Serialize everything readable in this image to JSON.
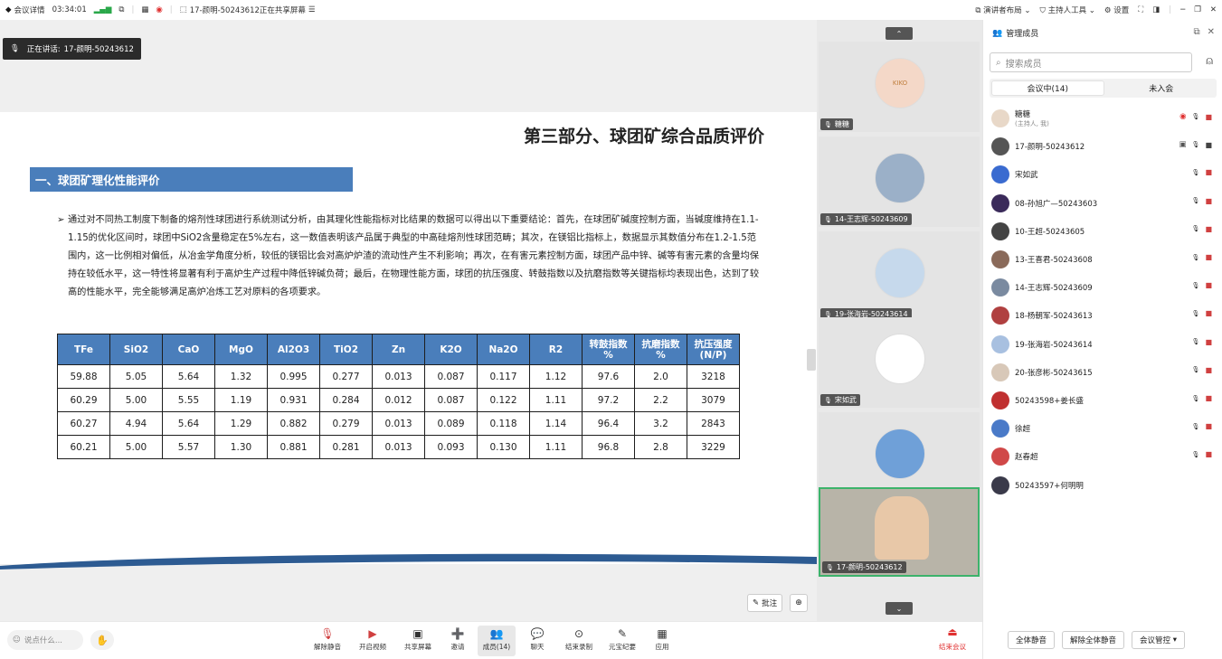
{
  "topbar": {
    "meeting_details": "会议详情",
    "duration": "03:34:01",
    "sharing": "17-颜明-50243612正在共享屏幕",
    "presenter_layout": "演讲者布局",
    "host_tools": "主持人工具",
    "settings": "设置"
  },
  "share": {
    "speaking_prefix": "正在讲话:",
    "speaking_name": "17-颜明-50243612"
  },
  "slide": {
    "title": "第三部分、球团矿综合品质评价",
    "section": "一、球团矿理化性能评价",
    "paragraph": "通过对不同热工制度下制备的熔剂性球团进行系统测试分析，由其理化性能指标对比结果的数据可以得出以下重要结论：首先，在球团矿碱度控制方面，当碱度维持在1.1-1.15的优化区间时，球团中SiO2含量稳定在5%左右，这一数值表明该产品属于典型的中高硅熔剂性球团范畴；其次，在镁铝比指标上，数据显示其数值分布在1.2-1.5范围内，这一比例相对偏低，从冶金学角度分析，较低的镁铝比会对高炉炉渣的流动性产生不利影响；再次，在有害元素控制方面，球团产品中锌、碱等有害元素的含量均保持在较低水平，这一特性将显著有利于高炉生产过程中降低锌碱负荷；最后，在物理性能方面，球团的抗压强度、转鼓指数以及抗磨指数等关键指标均表现出色，达到了较高的性能水平，完全能够满足高炉冶炼工艺对原料的各项要求。",
    "table": {
      "headers": [
        "TFe",
        "SiO2",
        "CaO",
        "MgO",
        "Al2O3",
        "TiO2",
        "Zn",
        "K2O",
        "Na2O",
        "R2",
        "转鼓指数%",
        "抗磨指数%",
        "抗压强度(N/P)"
      ],
      "header_lines": [
        [
          "TFe"
        ],
        [
          "SiO2"
        ],
        [
          "CaO"
        ],
        [
          "MgO"
        ],
        [
          "Al2O3"
        ],
        [
          "TiO2"
        ],
        [
          "Zn"
        ],
        [
          "K2O"
        ],
        [
          "Na2O"
        ],
        [
          "R2"
        ],
        [
          "转鼓指数",
          "%"
        ],
        [
          "抗磨指数",
          "%"
        ],
        [
          "抗压强度",
          "(N/P)"
        ]
      ],
      "rows": [
        [
          "59.88",
          "5.05",
          "5.64",
          "1.32",
          "0.995",
          "0.277",
          "0.013",
          "0.087",
          "0.117",
          "1.12",
          "97.6",
          "2.0",
          "3218"
        ],
        [
          "60.29",
          "5.00",
          "5.55",
          "1.19",
          "0.931",
          "0.284",
          "0.012",
          "0.087",
          "0.122",
          "1.11",
          "97.2",
          "2.2",
          "3079"
        ],
        [
          "60.27",
          "4.94",
          "5.64",
          "1.29",
          "0.882",
          "0.279",
          "0.013",
          "0.089",
          "0.118",
          "1.14",
          "96.4",
          "3.2",
          "2843"
        ],
        [
          "60.21",
          "5.00",
          "5.57",
          "1.30",
          "0.881",
          "0.281",
          "0.013",
          "0.093",
          "0.130",
          "1.11",
          "96.8",
          "2.8",
          "3229"
        ]
      ]
    }
  },
  "annotate_label": "批注",
  "video_tiles": [
    {
      "name": "糖糖",
      "color": "#f4d8c8",
      "avatar_text": "KIKO"
    },
    {
      "name": "14-王志辉-50243609",
      "color": "#9bb0c8",
      "avatar_text": ""
    },
    {
      "name": "19-张海岩-50243614",
      "color": "#c6d9ec",
      "avatar_text": ""
    },
    {
      "name": "宋如武",
      "color": "#ffffff",
      "avatar_text": ""
    },
    {
      "name": "徐超",
      "color": "#6fa0d8",
      "avatar_text": ""
    },
    {
      "name": "17-颜明-50243612",
      "color": "#b8b4a8",
      "avatar_text": ""
    }
  ],
  "panel": {
    "title": "管理成员",
    "search_placeholder": "搜索成员",
    "tab_in_meeting": "会议中(14)",
    "tab_not_joined": "未入会",
    "members": [
      {
        "name": "糖糖",
        "sub": "(主持人, 我)",
        "color": "#e8d8c8"
      },
      {
        "name": "17-颜明-50243612",
        "sub": "",
        "color": "#555555"
      },
      {
        "name": "宋如武",
        "sub": "",
        "color": "#3a6bd0"
      },
      {
        "name": "08-孙旭广—50243603",
        "sub": "",
        "color": "#3a2a5a"
      },
      {
        "name": "10-王超-50243605",
        "sub": "",
        "color": "#444444"
      },
      {
        "name": "13-王喜君-50243608",
        "sub": "",
        "color": "#8a6a5a"
      },
      {
        "name": "14-王志辉-50243609",
        "sub": "",
        "color": "#7a8aa0"
      },
      {
        "name": "18-杨朝军-50243613",
        "sub": "",
        "color": "#b04040"
      },
      {
        "name": "19-张海岩-50243614",
        "sub": "",
        "color": "#a8c0e0"
      },
      {
        "name": "20-张彦彬-50243615",
        "sub": "",
        "color": "#d8c8b8"
      },
      {
        "name": "50243598+姜长盛",
        "sub": "",
        "color": "#c03030"
      },
      {
        "name": "徐超",
        "sub": "",
        "color": "#4a7ac8"
      },
      {
        "name": "赵春超",
        "sub": "",
        "color": "#d04848"
      },
      {
        "name": "50243597+何明明",
        "sub": "",
        "color": "#3a3a4a"
      }
    ],
    "mute_all": "全体静音",
    "unmute_all": "解除全体静音",
    "controls": "会议管控"
  },
  "bottombar": {
    "say_placeholder": "说点什么...",
    "buttons": [
      "解除静音",
      "开启视频",
      "共享屏幕",
      "邀请",
      "成员(14)",
      "聊天",
      "结束录制",
      "元宝纪要",
      "应用"
    ],
    "end": "结束会议"
  }
}
